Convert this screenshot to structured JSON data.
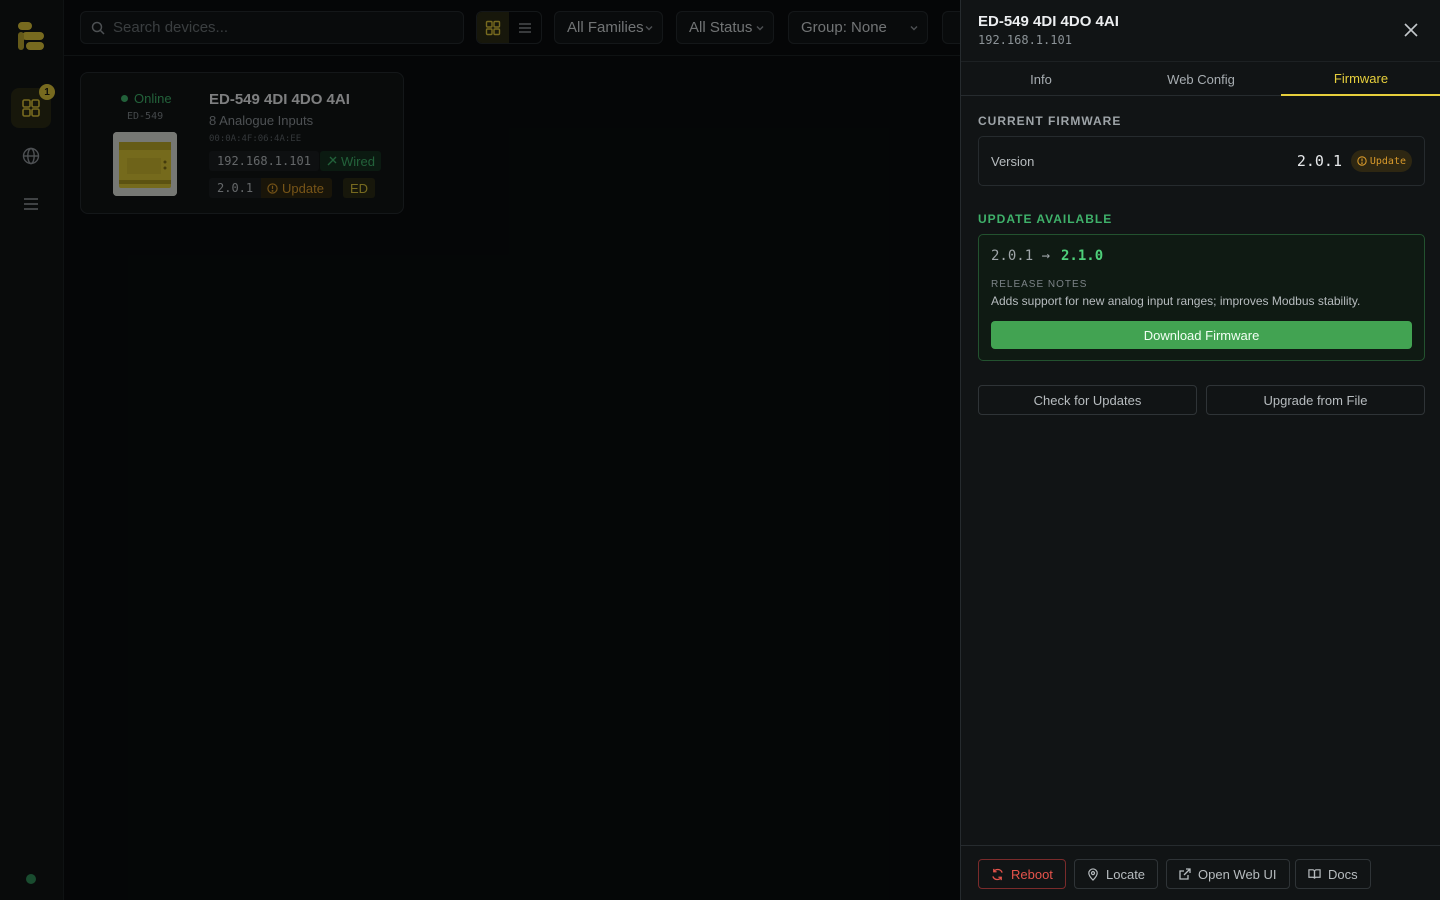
{
  "rail": {
    "badge_count": "1",
    "items": [
      "devices-icon",
      "globe-icon",
      "menu-icon"
    ],
    "accent": "#d9c23a"
  },
  "toolbar": {
    "search_placeholder": "Search devices...",
    "filters": [
      {
        "label": "All Families"
      },
      {
        "label": "All Status"
      },
      {
        "label": "Group: None"
      }
    ]
  },
  "device_card": {
    "status": "Online",
    "model": "ED-549",
    "title": "ED-549 4DI 4DO 4AI",
    "subtitle": "8 Analogue Inputs",
    "mac": "00:0A:4F:06:4A:EE",
    "ip": "192.168.1.101",
    "connection": "Wired",
    "firmware": "2.0.1",
    "update_label": "Update",
    "family": "ED"
  },
  "drawer": {
    "title": "ED-549 4DI 4DO 4AI",
    "ip": "192.168.1.101",
    "tabs": [
      {
        "label": "Info",
        "active": false
      },
      {
        "label": "Web Config",
        "active": false
      },
      {
        "label": "Firmware",
        "active": true
      }
    ],
    "current_firmware": {
      "heading": "CURRENT FIRMWARE",
      "label": "Version",
      "value": "2.0.1",
      "badge": "Update"
    },
    "update_available": {
      "heading": "UPDATE AVAILABLE",
      "from": "2.0.1",
      "arrow": "→",
      "to": "2.1.0",
      "notes_heading": "RELEASE NOTES",
      "notes": "Adds support for new analog input ranges; improves Modbus stability.",
      "download_label": "Download Firmware"
    },
    "actions": {
      "check_label": "Check for Updates",
      "upgrade_label": "Upgrade from File"
    },
    "footer": {
      "reboot": "Reboot",
      "locate": "Locate",
      "open_web_ui": "Open Web UI",
      "docs": "Docs"
    }
  },
  "colors": {
    "online": "#3fb16a",
    "update": "#d99a2b",
    "accent": "#e6cf3c",
    "download": "#42a352",
    "danger": "#e5534b"
  }
}
